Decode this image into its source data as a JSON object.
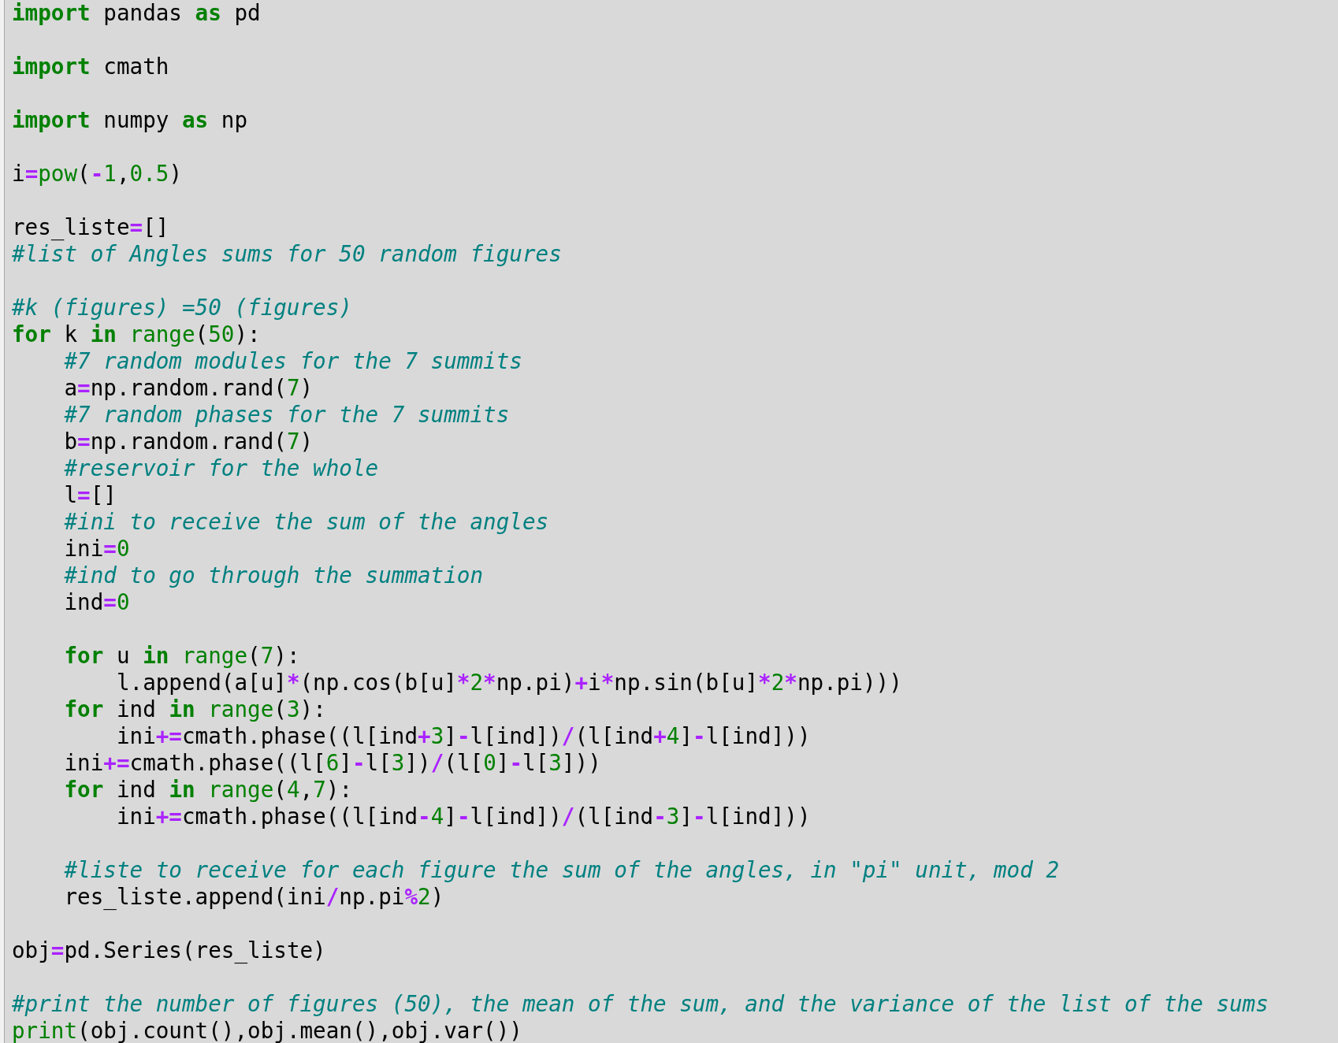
{
  "editor": {
    "lines": [
      {
        "kind": "code",
        "tokens": [
          {
            "kind": "keyword",
            "text": "import"
          },
          {
            "kind": "plain",
            "text": " pandas "
          },
          {
            "kind": "keyword",
            "text": "as"
          },
          {
            "kind": "plain",
            "text": " pd"
          }
        ]
      },
      {
        "kind": "blank"
      },
      {
        "kind": "code",
        "tokens": [
          {
            "kind": "keyword",
            "text": "import"
          },
          {
            "kind": "plain",
            "text": " cmath"
          }
        ]
      },
      {
        "kind": "blank"
      },
      {
        "kind": "code",
        "tokens": [
          {
            "kind": "keyword",
            "text": "import"
          },
          {
            "kind": "plain",
            "text": " numpy "
          },
          {
            "kind": "keyword",
            "text": "as"
          },
          {
            "kind": "plain",
            "text": " np"
          }
        ]
      },
      {
        "kind": "blank"
      },
      {
        "kind": "code",
        "tokens": [
          {
            "kind": "plain",
            "text": "i"
          },
          {
            "kind": "operator",
            "text": "="
          },
          {
            "kind": "builtin",
            "text": "pow"
          },
          {
            "kind": "plain",
            "text": "("
          },
          {
            "kind": "operator",
            "text": "-"
          },
          {
            "kind": "number",
            "text": "1"
          },
          {
            "kind": "plain",
            "text": ","
          },
          {
            "kind": "number",
            "text": "0.5"
          },
          {
            "kind": "plain",
            "text": ")"
          }
        ]
      },
      {
        "kind": "blank"
      },
      {
        "kind": "code",
        "tokens": [
          {
            "kind": "plain",
            "text": "res_liste"
          },
          {
            "kind": "operator",
            "text": "="
          },
          {
            "kind": "plain",
            "text": "[]"
          }
        ]
      },
      {
        "kind": "code",
        "tokens": [
          {
            "kind": "comment",
            "text": "#list of Angles sums for 50 random figures"
          }
        ]
      },
      {
        "kind": "blank"
      },
      {
        "kind": "code",
        "tokens": [
          {
            "kind": "comment",
            "text": "#k (figures) =50 (figures)"
          }
        ]
      },
      {
        "kind": "code",
        "tokens": [
          {
            "kind": "keyword",
            "text": "for"
          },
          {
            "kind": "plain",
            "text": " k "
          },
          {
            "kind": "keyword",
            "text": "in"
          },
          {
            "kind": "builtin",
            "text": " range"
          },
          {
            "kind": "plain",
            "text": "("
          },
          {
            "kind": "number",
            "text": "50"
          },
          {
            "kind": "plain",
            "text": "):"
          }
        ]
      },
      {
        "kind": "code",
        "tokens": [
          {
            "kind": "comment",
            "text": "    #7 random modules for the 7 summits"
          }
        ]
      },
      {
        "kind": "code",
        "tokens": [
          {
            "kind": "plain",
            "text": "    a"
          },
          {
            "kind": "operator",
            "text": "="
          },
          {
            "kind": "plain",
            "text": "np.random.rand("
          },
          {
            "kind": "number",
            "text": "7"
          },
          {
            "kind": "plain",
            "text": ")"
          }
        ]
      },
      {
        "kind": "code",
        "tokens": [
          {
            "kind": "comment",
            "text": "    #7 random phases for the 7 summits"
          }
        ]
      },
      {
        "kind": "code",
        "tokens": [
          {
            "kind": "plain",
            "text": "    b"
          },
          {
            "kind": "operator",
            "text": "="
          },
          {
            "kind": "plain",
            "text": "np.random.rand("
          },
          {
            "kind": "number",
            "text": "7"
          },
          {
            "kind": "plain",
            "text": ")"
          }
        ]
      },
      {
        "kind": "code",
        "tokens": [
          {
            "kind": "comment",
            "text": "    #reservoir for the whole"
          }
        ]
      },
      {
        "kind": "code",
        "tokens": [
          {
            "kind": "plain",
            "text": "    l"
          },
          {
            "kind": "operator",
            "text": "="
          },
          {
            "kind": "plain",
            "text": "[]"
          }
        ]
      },
      {
        "kind": "code",
        "tokens": [
          {
            "kind": "comment",
            "text": "    #ini to receive the sum of the angles"
          }
        ]
      },
      {
        "kind": "code",
        "tokens": [
          {
            "kind": "plain",
            "text": "    ini"
          },
          {
            "kind": "operator",
            "text": "="
          },
          {
            "kind": "number",
            "text": "0"
          }
        ]
      },
      {
        "kind": "code",
        "tokens": [
          {
            "kind": "comment",
            "text": "    #ind to go through the summation"
          }
        ]
      },
      {
        "kind": "code",
        "tokens": [
          {
            "kind": "plain",
            "text": "    ind"
          },
          {
            "kind": "operator",
            "text": "="
          },
          {
            "kind": "number",
            "text": "0"
          }
        ]
      },
      {
        "kind": "blank"
      },
      {
        "kind": "code",
        "tokens": [
          {
            "kind": "keyword",
            "text": "    for"
          },
          {
            "kind": "plain",
            "text": " u "
          },
          {
            "kind": "keyword",
            "text": "in"
          },
          {
            "kind": "builtin",
            "text": " range"
          },
          {
            "kind": "plain",
            "text": "("
          },
          {
            "kind": "number",
            "text": "7"
          },
          {
            "kind": "plain",
            "text": "):"
          }
        ]
      },
      {
        "kind": "code",
        "tokens": [
          {
            "kind": "plain",
            "text": "        l.append(a[u]"
          },
          {
            "kind": "operator",
            "text": "*"
          },
          {
            "kind": "plain",
            "text": "(np.cos(b[u]"
          },
          {
            "kind": "operator",
            "text": "*"
          },
          {
            "kind": "number",
            "text": "2"
          },
          {
            "kind": "operator",
            "text": "*"
          },
          {
            "kind": "plain",
            "text": "np.pi)"
          },
          {
            "kind": "operator",
            "text": "+"
          },
          {
            "kind": "plain",
            "text": "i"
          },
          {
            "kind": "operator",
            "text": "*"
          },
          {
            "kind": "plain",
            "text": "np.sin(b[u]"
          },
          {
            "kind": "operator",
            "text": "*"
          },
          {
            "kind": "number",
            "text": "2"
          },
          {
            "kind": "operator",
            "text": "*"
          },
          {
            "kind": "plain",
            "text": "np.pi)))"
          }
        ]
      },
      {
        "kind": "code",
        "tokens": [
          {
            "kind": "keyword",
            "text": "    for"
          },
          {
            "kind": "plain",
            "text": " ind "
          },
          {
            "kind": "keyword",
            "text": "in"
          },
          {
            "kind": "builtin",
            "text": " range"
          },
          {
            "kind": "plain",
            "text": "("
          },
          {
            "kind": "number",
            "text": "3"
          },
          {
            "kind": "plain",
            "text": "):"
          }
        ]
      },
      {
        "kind": "code",
        "tokens": [
          {
            "kind": "plain",
            "text": "        ini"
          },
          {
            "kind": "operator",
            "text": "+="
          },
          {
            "kind": "plain",
            "text": "cmath.phase((l[ind"
          },
          {
            "kind": "operator",
            "text": "+"
          },
          {
            "kind": "number",
            "text": "3"
          },
          {
            "kind": "plain",
            "text": "]"
          },
          {
            "kind": "operator",
            "text": "-"
          },
          {
            "kind": "plain",
            "text": "l[ind])"
          },
          {
            "kind": "operator",
            "text": "/"
          },
          {
            "kind": "plain",
            "text": "(l[ind"
          },
          {
            "kind": "operator",
            "text": "+"
          },
          {
            "kind": "number",
            "text": "4"
          },
          {
            "kind": "plain",
            "text": "]"
          },
          {
            "kind": "operator",
            "text": "-"
          },
          {
            "kind": "plain",
            "text": "l[ind]))"
          }
        ]
      },
      {
        "kind": "code",
        "tokens": [
          {
            "kind": "plain",
            "text": "    ini"
          },
          {
            "kind": "operator",
            "text": "+="
          },
          {
            "kind": "plain",
            "text": "cmath.phase((l["
          },
          {
            "kind": "number",
            "text": "6"
          },
          {
            "kind": "plain",
            "text": "]"
          },
          {
            "kind": "operator",
            "text": "-"
          },
          {
            "kind": "plain",
            "text": "l["
          },
          {
            "kind": "number",
            "text": "3"
          },
          {
            "kind": "plain",
            "text": "])"
          },
          {
            "kind": "operator",
            "text": "/"
          },
          {
            "kind": "plain",
            "text": "(l["
          },
          {
            "kind": "number",
            "text": "0"
          },
          {
            "kind": "plain",
            "text": "]"
          },
          {
            "kind": "operator",
            "text": "-"
          },
          {
            "kind": "plain",
            "text": "l["
          },
          {
            "kind": "number",
            "text": "3"
          },
          {
            "kind": "plain",
            "text": "]))"
          }
        ]
      },
      {
        "kind": "code",
        "tokens": [
          {
            "kind": "keyword",
            "text": "    for"
          },
          {
            "kind": "plain",
            "text": " ind "
          },
          {
            "kind": "keyword",
            "text": "in"
          },
          {
            "kind": "builtin",
            "text": " range"
          },
          {
            "kind": "plain",
            "text": "("
          },
          {
            "kind": "number",
            "text": "4"
          },
          {
            "kind": "plain",
            "text": ","
          },
          {
            "kind": "number",
            "text": "7"
          },
          {
            "kind": "plain",
            "text": "):"
          }
        ]
      },
      {
        "kind": "code",
        "tokens": [
          {
            "kind": "plain",
            "text": "        ini"
          },
          {
            "kind": "operator",
            "text": "+="
          },
          {
            "kind": "plain",
            "text": "cmath.phase((l[ind"
          },
          {
            "kind": "operator",
            "text": "-"
          },
          {
            "kind": "number",
            "text": "4"
          },
          {
            "kind": "plain",
            "text": "]"
          },
          {
            "kind": "operator",
            "text": "-"
          },
          {
            "kind": "plain",
            "text": "l[ind])"
          },
          {
            "kind": "operator",
            "text": "/"
          },
          {
            "kind": "plain",
            "text": "(l[ind"
          },
          {
            "kind": "operator",
            "text": "-"
          },
          {
            "kind": "number",
            "text": "3"
          },
          {
            "kind": "plain",
            "text": "]"
          },
          {
            "kind": "operator",
            "text": "-"
          },
          {
            "kind": "plain",
            "text": "l[ind]))"
          }
        ]
      },
      {
        "kind": "blank"
      },
      {
        "kind": "code",
        "tokens": [
          {
            "kind": "comment",
            "text": "    #liste to receive for each figure the sum of the angles, in \"pi\" unit, mod 2"
          }
        ]
      },
      {
        "kind": "code",
        "tokens": [
          {
            "kind": "plain",
            "text": "    res_liste.append(ini"
          },
          {
            "kind": "operator",
            "text": "/"
          },
          {
            "kind": "plain",
            "text": "np.pi"
          },
          {
            "kind": "operator",
            "text": "%"
          },
          {
            "kind": "number",
            "text": "2"
          },
          {
            "kind": "plain",
            "text": ")"
          }
        ]
      },
      {
        "kind": "blank"
      },
      {
        "kind": "code",
        "tokens": [
          {
            "kind": "plain",
            "text": "obj"
          },
          {
            "kind": "operator",
            "text": "="
          },
          {
            "kind": "plain",
            "text": "pd.Series(res_liste)"
          }
        ]
      },
      {
        "kind": "blank"
      },
      {
        "kind": "code",
        "tokens": [
          {
            "kind": "comment",
            "text": "#print the number of figures (50), the mean of the sum, and the variance of the list of the sums"
          }
        ]
      },
      {
        "kind": "code",
        "tokens": [
          {
            "kind": "builtin",
            "text": "print"
          },
          {
            "kind": "plain",
            "text": "(obj.count(),obj.mean(),obj.var())"
          }
        ]
      }
    ]
  }
}
